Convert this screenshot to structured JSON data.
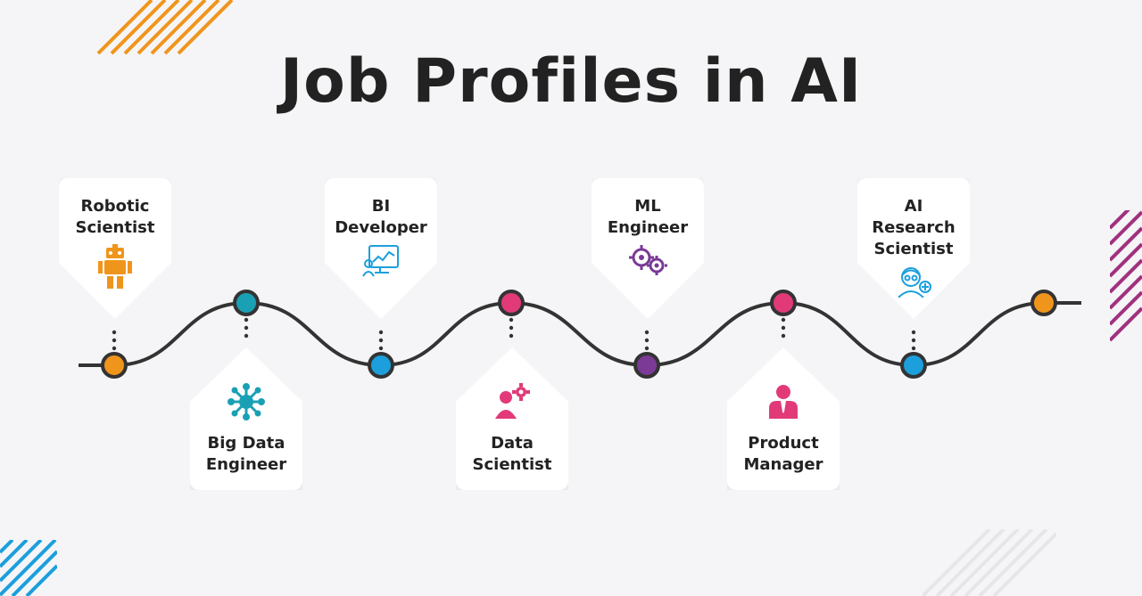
{
  "title": "Job Profiles in AI",
  "colors": {
    "orange": "#f0951c",
    "teal": "#1aa0b5",
    "blue": "#1c9fdc",
    "pink": "#e23a79",
    "purple": "#7a3a96",
    "line": "#333333"
  },
  "profiles": [
    {
      "label": "Robotic Scientist",
      "icon": "robot-icon",
      "color": "#f0951c",
      "position": "top"
    },
    {
      "label": "Big Data Engineer",
      "icon": "network-icon",
      "color": "#1aa0b5",
      "position": "bottom"
    },
    {
      "label": "BI Developer",
      "icon": "dashboard-icon",
      "color": "#1c9fdc",
      "position": "top"
    },
    {
      "label": "Data Scientist",
      "icon": "person-gear-icon",
      "color": "#e23a79",
      "position": "bottom"
    },
    {
      "label": "ML Engineer",
      "icon": "gears-icon",
      "color": "#7a3a96",
      "position": "top"
    },
    {
      "label": "Product Manager",
      "icon": "manager-icon",
      "color": "#e23a79",
      "position": "bottom"
    },
    {
      "label": "AI Research Scientist",
      "icon": "researcher-icon",
      "color": "#1c9fdc",
      "position": "top"
    }
  ]
}
